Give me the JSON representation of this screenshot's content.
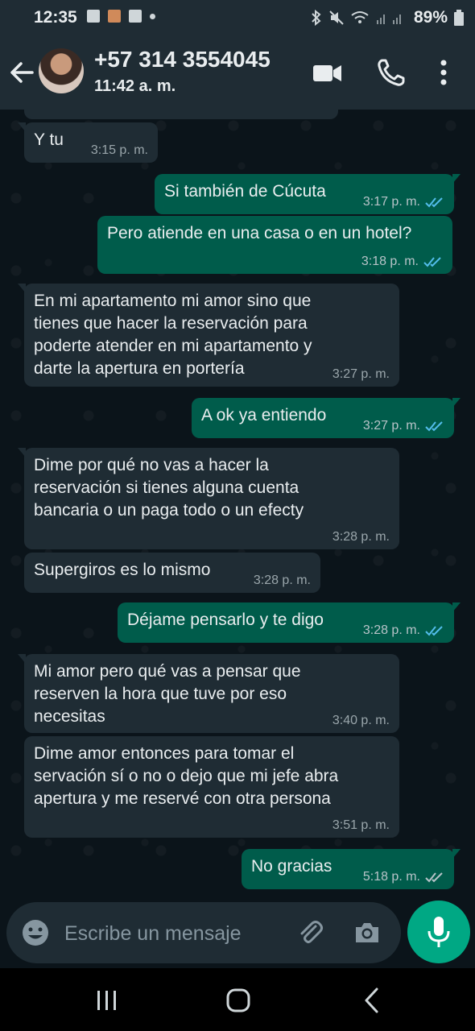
{
  "status_bar": {
    "time": "12:35",
    "battery": "89%"
  },
  "header": {
    "contact_name": "+57 314 3554045",
    "last_seen": "11:42 a. m."
  },
  "messages": [
    {
      "dir": "in",
      "text": "Y tu",
      "time": "3:15 p. m."
    },
    {
      "dir": "out",
      "text": "Si también de Cúcuta",
      "time": "3:17 p. m."
    },
    {
      "dir": "out",
      "text": "Pero atiende en una casa o en un hotel?",
      "time": "3:18 p. m."
    },
    {
      "dir": "in",
      "text": "En mi apartamento mi amor sino que\ntienes que hacer la reservación para\npoderte atender en mi apartamento y\ndarte la apertura en portería",
      "time": "3:27 p. m."
    },
    {
      "dir": "out",
      "text": "A ok ya entiendo",
      "time": "3:27 p. m."
    },
    {
      "dir": "in",
      "text": "Dime por qué no vas a hacer la\nreservación si tienes alguna cuenta\nbancaria o un paga todo o un efecty",
      "time": "3:28 p. m."
    },
    {
      "dir": "in",
      "text": "Supergiros es lo mismo",
      "time": "3:28 p. m."
    },
    {
      "dir": "out",
      "text": "Déjame pensarlo y te digo",
      "time": "3:28 p. m."
    },
    {
      "dir": "in",
      "text": "Mi amor pero qué vas a pensar que\nreserven la hora que tuve por eso\nnecesitas",
      "time": "3:40 p. m."
    },
    {
      "dir": "in",
      "text": "Dime amor entonces para tomar el\nservación sí o no o dejo que mi jefe abra\napertura y me reservé con otra persona",
      "time": "3:51 p. m."
    },
    {
      "dir": "out",
      "text": "No gracias",
      "time": "5:18 p. m."
    }
  ],
  "composer": {
    "placeholder": "Escribe un mensaje"
  },
  "colors": {
    "header_bg": "#1f2c34",
    "incoming_bubble": "#1f2c34",
    "outgoing_bubble": "#005c4b",
    "read_ticks": "#53bdeb",
    "mic_button": "#00a884"
  }
}
